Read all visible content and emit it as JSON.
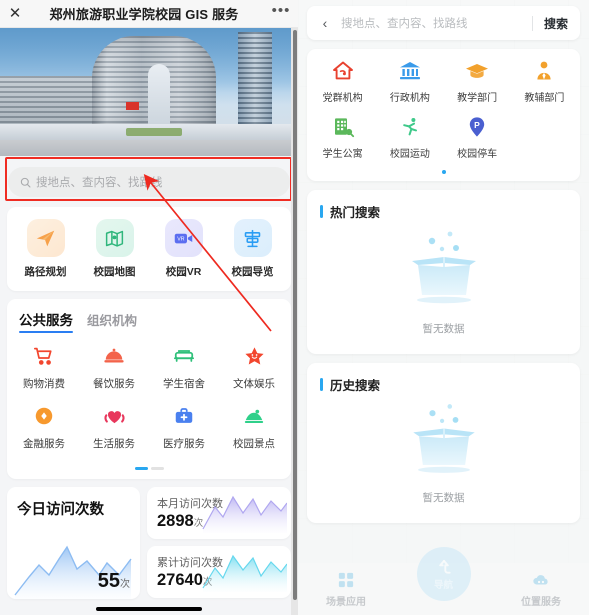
{
  "window": {
    "title": "郑州旅游职业学院校园 GIS 服务",
    "close_icon": "close-x-icon",
    "more_icon": "more-dots-icon"
  },
  "left": {
    "banner_alt": "campus-building-banner",
    "search": {
      "placeholder": "搜地点、查内容、找路线",
      "value": "",
      "icon": "search-icon",
      "highlight_color": "#ef2c23"
    },
    "quick_actions": [
      {
        "label": "路径规划",
        "icon": "paper-plane-icon",
        "color": "#f7a14a"
      },
      {
        "label": "校园地图",
        "icon": "map-pin-icon",
        "color": "#2fb67c"
      },
      {
        "label": "校园VR",
        "icon": "vr-camera-icon",
        "color": "#5b6ef0"
      },
      {
        "label": "校园导览",
        "icon": "signpost-icon",
        "color": "#2a9df4"
      }
    ],
    "services": {
      "tabs": [
        {
          "label": "公共服务",
          "active": true
        },
        {
          "label": "组织机构",
          "active": false
        }
      ],
      "items": [
        {
          "label": "购物消费",
          "icon": "shopping-cart-icon",
          "color": "#f2462e"
        },
        {
          "label": "餐饮服务",
          "icon": "food-cloche-icon",
          "color": "#f3634a"
        },
        {
          "label": "学生宿舍",
          "icon": "bed-icon",
          "color": "#2fc07a"
        },
        {
          "label": "文体娱乐",
          "icon": "star-face-icon",
          "color": "#f2462e"
        },
        {
          "label": "金融服务",
          "icon": "coin-icon",
          "color": "#f7992e"
        },
        {
          "label": "生活服务",
          "icon": "heart-hands-icon",
          "color": "#e8375c"
        },
        {
          "label": "医疗服务",
          "icon": "medical-kit-icon",
          "color": "#4a80ef"
        },
        {
          "label": "校园景点",
          "icon": "landscape-icon",
          "color": "#2fd08a"
        }
      ],
      "pagination": {
        "pages": 2,
        "active": 1
      }
    },
    "stats": {
      "today": {
        "title": "今日访问次数",
        "value": "55",
        "unit": "次",
        "spark_color": "#7fb6f0"
      },
      "month": {
        "title": "本月访问次数",
        "value": "2898",
        "unit": "次",
        "spark_color": "#b0a7f0"
      },
      "total": {
        "title": "累计访问次数",
        "value": "27640",
        "unit": "次",
        "spark_color": "#66d8ee"
      }
    },
    "home_indicator": true
  },
  "right": {
    "search": {
      "back_icon": "chevron-left-icon",
      "placeholder": "搜地点、查内容、找路线",
      "value": "",
      "button_label": "搜索"
    },
    "categories": [
      {
        "label": "党群机构",
        "icon": "party-house-icon",
        "color": "#e8412f"
      },
      {
        "label": "行政机构",
        "icon": "bank-building-icon",
        "color": "#3a9bea"
      },
      {
        "label": "教学部门",
        "icon": "graduation-cap-icon",
        "color": "#f2a12c"
      },
      {
        "label": "教辅部门",
        "icon": "person-tie-icon",
        "color": "#f2a12c"
      },
      {
        "label": "学生公寓",
        "icon": "apartment-icon",
        "color": "#5bb85b"
      },
      {
        "label": "校园运动",
        "icon": "runner-icon",
        "color": "#3fc98a"
      },
      {
        "label": "校园停车",
        "icon": "parking-pin-icon",
        "color": "#4a5fd0"
      }
    ],
    "categories_pagination": {
      "pages": 1,
      "active": 1
    },
    "hot_search": {
      "title": "热门搜索",
      "empty_text": "暂无数据",
      "empty_icon": "empty-box-icon"
    },
    "history_search": {
      "title": "历史搜索",
      "empty_text": "暂无数据",
      "empty_icon": "empty-box-icon"
    },
    "bottom_nav": [
      {
        "label": "场景应用",
        "icon": "grid-apps-icon"
      },
      {
        "label": "位置服务",
        "icon": "location-cloud-icon"
      }
    ],
    "nav_center": {
      "label": "导航",
      "icon": "navigation-arrow-icon"
    }
  }
}
